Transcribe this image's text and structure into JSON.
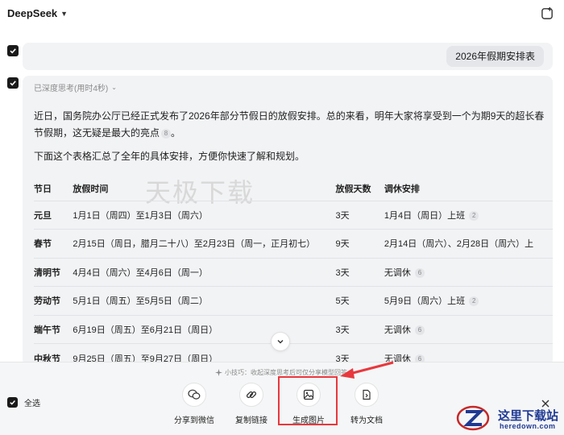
{
  "header": {
    "app_name": "DeepSeek"
  },
  "user_message": "2026年假期安排表",
  "assistant": {
    "think_label": "已深度思考(用时4秒)",
    "paragraph1": "近日，国务院办公厅已经正式发布了2026年部分节假日的放假安排。总的来看，明年大家将享受到一个为期9天的超长春节假期，这无疑是最大的亮点",
    "paragraph1_cite": "8",
    "paragraph1_end": "。",
    "paragraph2": "下面这个表格汇总了全年的具体安排，方便你快速了解和规划。",
    "table": {
      "headers": [
        "节日",
        "放假时间",
        "放假天数",
        "调休安排"
      ],
      "rows": [
        {
          "holiday": "元旦",
          "time": "1月1日（周四）至1月3日（周六）",
          "days": "3天",
          "adjust": "1月4日（周日）上班",
          "cite": "2"
        },
        {
          "holiday": "春节",
          "time": "2月15日（周日，腊月二十八）至2月23日（周一，正月初七）",
          "days": "9天",
          "adjust": "2月14日（周六）、2月28日（周六）上",
          "cite": ""
        },
        {
          "holiday": "清明节",
          "time": "4月4日（周六）至4月6日（周一）",
          "days": "3天",
          "adjust": "无调休",
          "cite": "6"
        },
        {
          "holiday": "劳动节",
          "time": "5月1日（周五）至5月5日（周二）",
          "days": "5天",
          "adjust": "5月9日（周六）上班",
          "cite": "2"
        },
        {
          "holiday": "端午节",
          "time": "6月19日（周五）至6月21日（周日）",
          "days": "3天",
          "adjust": "无调休",
          "cite": "6"
        },
        {
          "holiday": "中秋节",
          "time": "9月25日（周五）至9月27日（周日）",
          "days": "3天",
          "adjust": "无调休",
          "cite": "6"
        }
      ]
    }
  },
  "watermark": "天极下载",
  "share_bar": {
    "tip": "小技巧：收起深度思考后可仅分享模型回答",
    "select_all": "全选",
    "actions": [
      {
        "label": "分享到微信",
        "icon": "wechat-icon"
      },
      {
        "label": "复制链接",
        "icon": "link-icon"
      },
      {
        "label": "生成图片",
        "icon": "image-icon"
      },
      {
        "label": "转为文档",
        "icon": "document-icon"
      }
    ]
  },
  "site_logo": {
    "line1": "这里下载站",
    "line2": "heredown.com"
  },
  "colors": {
    "highlight": "#e8383d",
    "logo_blue": "#1f3a93",
    "panel_bg": "#f2f3f5"
  }
}
